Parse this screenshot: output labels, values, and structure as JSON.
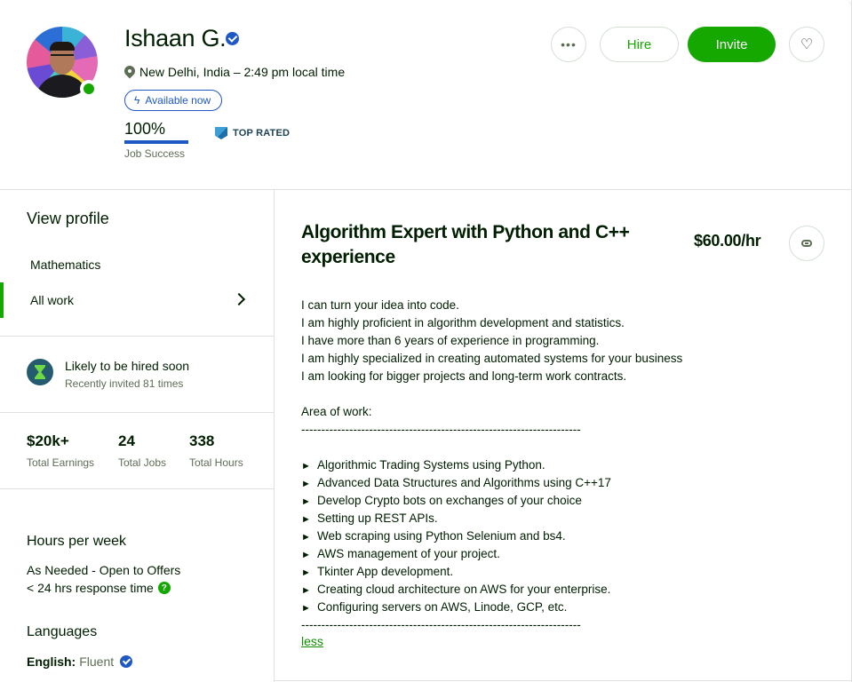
{
  "profile": {
    "name": "Ishaan G.",
    "location": "New Delhi, India – 2:49 pm local time",
    "availability": "Available now",
    "job_success_value": "100%",
    "job_success_percent": 100,
    "job_success_label": "Job Success",
    "badge": "TOP RATED",
    "online": true
  },
  "actions": {
    "more_label": "•••",
    "hire_label": "Hire",
    "invite_label": "Invite",
    "favorite_icon": "heart-icon",
    "copy_link_icon": "link-icon"
  },
  "sidebar": {
    "view_profile": "View profile",
    "items": [
      {
        "label": "Mathematics",
        "active": false
      },
      {
        "label": "All work",
        "active": true
      }
    ],
    "hired": {
      "title": "Likely to be hired soon",
      "subtitle": "Recently invited 81 times"
    },
    "stats": [
      {
        "value": "$20k+",
        "label": "Total Earnings"
      },
      {
        "value": "24",
        "label": "Total Jobs"
      },
      {
        "value": "338",
        "label": "Total Hours"
      }
    ],
    "hours_per_week": {
      "title": "Hours per week",
      "availability": "As Needed - Open to Offers",
      "response": "< 24 hrs response time"
    },
    "languages": {
      "title": "Languages",
      "items": [
        {
          "name": "English:",
          "level": "Fluent"
        }
      ]
    }
  },
  "main": {
    "title": "Algorithm Expert with Python and C++ experience",
    "rate": "$60.00/hr",
    "intro": [
      "I can turn your idea into code.",
      "I am highly proficient in algorithm development and statistics.",
      "I have more than 6 years of experience in programming.",
      "I am highly specialized in creating automated systems for your business",
      "I am looking for bigger projects and long-term work contracts."
    ],
    "area_heading": "Area of work:",
    "separator": "----------------------------------------------------------------------",
    "bullet_glyph": "►",
    "areas": [
      "Algorithmic Trading Systems using Python.",
      "Advanced Data Structures and Algorithms using C++17",
      "Develop Crypto bots on exchanges of your choice",
      "Setting up REST APIs.",
      "Web scraping using Python Selenium and bs4.",
      "AWS management of your project.",
      "Tkinter App development.",
      "Creating cloud architecture on AWS for your enterprise.",
      "Configuring servers on AWS, Linode, GCP, etc."
    ],
    "less_label": "less"
  },
  "colors": {
    "brand_green": "#14a800",
    "verified_blue": "#1f57c3",
    "top_rated_navy": "#1d4354"
  }
}
